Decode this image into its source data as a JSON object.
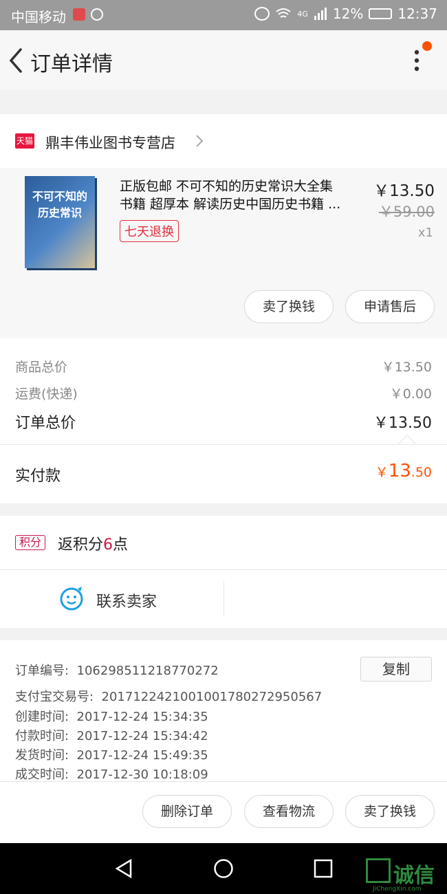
{
  "status_bar": {
    "carrier": "中国移动",
    "network": "4G",
    "battery": "12%",
    "time": "12:37"
  },
  "header": {
    "title": "订单详情"
  },
  "store": {
    "badge": "天猫",
    "name": "鼎丰伟业图书专营店"
  },
  "product": {
    "cover_title": "不可不知的历史常识",
    "title_line1": "正版包邮 不可不知的历史常识大全集",
    "title_line2": "书籍 超厚本 解读历史中国历史书籍 ...",
    "tag": "七天退换",
    "price": "￥13.50",
    "original_price": "￥59.00",
    "quantity": "x1",
    "btn_sell": "卖了换钱",
    "btn_aftersale": "申请售后"
  },
  "totals": {
    "goods_label": "商品总价",
    "goods_value": "￥13.50",
    "shipping_label": "运费(快递)",
    "shipping_value": "￥0.00",
    "order_label": "订单总价",
    "order_value": "￥13.50",
    "paid_label": "实付款",
    "paid_currency": "￥",
    "paid_int": "13",
    "paid_dec": ".50"
  },
  "points": {
    "badge": "积分",
    "text_prefix": "返积分",
    "number": "6",
    "text_suffix": "点"
  },
  "contact": {
    "label": "联系卖家"
  },
  "order_info": {
    "order_no_label": "订单编号:",
    "order_no": "106298511218770272",
    "copy": "复制",
    "alipay_label": "支付宝交易号:",
    "alipay_no": "2017122421001001780272950567",
    "created_label": "创建时间:",
    "created": "2017-12-24 15:34:35",
    "paid_label": "付款时间:",
    "paid": "2017-12-24 15:34:42",
    "shipped_label": "发货时间:",
    "shipped": "2017-12-24 15:49:35",
    "done_label": "成交时间:",
    "done": "2017-12-30 10:18:09"
  },
  "actions": {
    "delete": "删除订单",
    "logistics": "查看物流",
    "sell": "卖了换钱"
  },
  "watermark": {
    "text": "诚信",
    "sub": "JiChengXin.com"
  },
  "colors": {
    "accent": "#ff5000",
    "tmall_red": "#e6163e",
    "points_red": "#c8164a"
  }
}
